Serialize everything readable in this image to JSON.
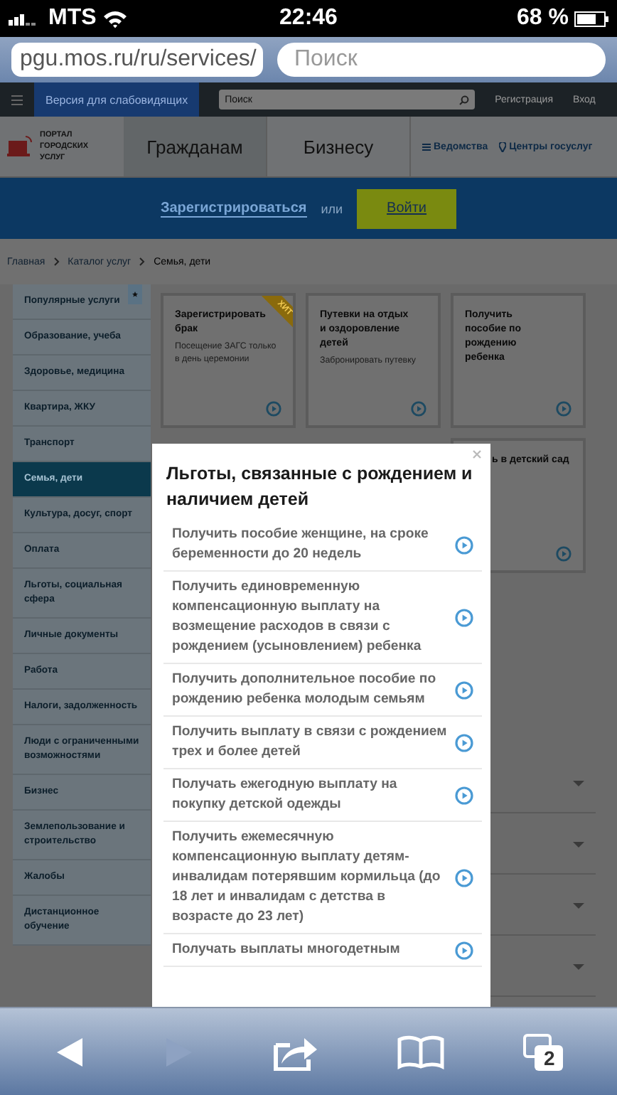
{
  "status_bar": {
    "carrier": "MTS",
    "time": "22:46",
    "battery": "68 %"
  },
  "browser": {
    "url": "pgu.mos.ru/ru/services/",
    "search_placeholder": "Поиск"
  },
  "top_nav": {
    "accessibility": "Версия для слабовидящих",
    "search_placeholder": "Поиск",
    "links": [
      "Регистрация",
      "Вход"
    ]
  },
  "header": {
    "logo_lines": [
      "ПОРТАЛ",
      "ГОРОДСКИХ",
      "УСЛУГ"
    ],
    "tabs": [
      {
        "label": "Гражданам",
        "selected": true
      },
      {
        "label": "Бизнесу",
        "selected": false
      }
    ],
    "links": [
      {
        "label": "Ведомства",
        "kind": "list"
      },
      {
        "label": "Центры госуслуг",
        "kind": "pin"
      }
    ]
  },
  "banner": {
    "register": "Зарегистрироваться",
    "or": "или",
    "login": "Войти"
  },
  "breadcrumbs": [
    "Главная",
    "Каталог услуг",
    "Семья, дети"
  ],
  "sidebar": {
    "items": [
      {
        "label": "Популярные услуги",
        "selected": false
      },
      {
        "label": "Образование, учеба",
        "selected": false
      },
      {
        "label": "Здоровье, медицина",
        "selected": false
      },
      {
        "label": "Квартира, ЖКУ",
        "selected": false
      },
      {
        "label": "Транспорт",
        "selected": false
      },
      {
        "label": "Семья, дети",
        "selected": true
      },
      {
        "label": "Культура, досуг, спорт",
        "selected": false
      },
      {
        "label": "Оплата",
        "selected": false
      },
      {
        "label": "Льготы, социальная сфера",
        "selected": false
      },
      {
        "label": "Личные документы",
        "selected": false
      },
      {
        "label": "Работа",
        "selected": false
      },
      {
        "label": "Налоги, задолженность",
        "selected": false
      },
      {
        "label": "Люди с ограниченными возможностями",
        "selected": false
      },
      {
        "label": "Бизнес",
        "selected": false
      },
      {
        "label": "Землепользование и строительство",
        "selected": false
      },
      {
        "label": "Жалобы",
        "selected": false
      },
      {
        "label": "Дистанционное обучение",
        "selected": false
      }
    ]
  },
  "cards": [
    {
      "kind": "full",
      "title": "Зарегистрировать брак",
      "subtitle": "Посещение ЗАГС только в день церемонии",
      "ribbon": "ХИТ"
    },
    {
      "kind": "full",
      "title": "Путевки на отдых и оздоровление детей",
      "subtitle": "Забронировать путевку"
    },
    {
      "kind": "full",
      "title": "Получить пособие по рождению ребенка"
    },
    {
      "kind": "covered",
      "title": "ь в детский сад"
    }
  ],
  "modal": {
    "title": "Льготы, связанные с рождением и наличием детей",
    "items": [
      "Получить пособие женщине, на сроке беременности до 20 недель",
      "Получить единовременную компенсационную выплату на возмещение расходов в связи с рождением (усыновлением) ребенка",
      "Получить дополнительное пособие по рождению ребенка молодым семьям",
      "Получить выплату в связи с рождением трех и более детей",
      "Получать ежегодную выплату на покупку детской одежды",
      "Получить ежемесячную компенсационную выплату детям-инвалидам потерявшим кормильца (до 18 лет и инвалидам с детства в возрасте до 23 лет)",
      "Получать выплаты многодетным"
    ]
  },
  "toolbar": {
    "forward": {
      "disabled": true
    },
    "tab_count": "2"
  }
}
